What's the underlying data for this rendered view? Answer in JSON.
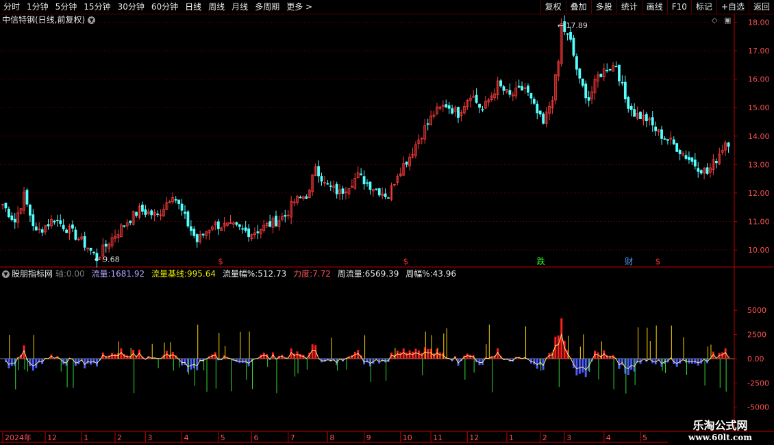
{
  "toolbar": {
    "left_items": [
      "分时",
      "1分钟",
      "5分钟",
      "15分钟",
      "30分钟",
      "60分钟",
      "日线",
      "周线",
      "月线",
      "多周期",
      "更多 >"
    ],
    "active": "日线",
    "right_items": [
      "复权",
      "叠加",
      "多股",
      "统计",
      "画线",
      "F10",
      "标记",
      "+自选",
      "返回"
    ]
  },
  "chart_title": "中信特钢(日线,前复权)",
  "price_axis": [
    "18.00",
    "17.00",
    "16.00",
    "15.00",
    "14.00",
    "13.00",
    "12.00",
    "11.00",
    "10.00"
  ],
  "high_label": "17.89",
  "low_label": "9.68",
  "event_marks": [
    {
      "text": "$",
      "color": "#ff3030",
      "day": 72
    },
    {
      "text": "$",
      "color": "#ff3030",
      "day": 133
    },
    {
      "text": "跌",
      "color": "#30ff30",
      "day": 177
    },
    {
      "text": "财",
      "color": "#4aa0ff",
      "day": 206
    },
    {
      "text": "$",
      "color": "#ff3030",
      "day": 216
    }
  ],
  "indicator": {
    "name": "股朋指标网",
    "axis_label": "轴:",
    "axis_value": "0.00",
    "flow_label": "流量:",
    "flow_value": "1681.92",
    "base_label": "流量基线:",
    "base_value": "995.64",
    "amp_label": "流量幅%:",
    "amp_value": "512.73",
    "force_label": "力度:",
    "force_value": "7.72",
    "week_flow_label": "周流量:",
    "week_flow_value": "6569.39",
    "week_amp_label": "周幅%:",
    "week_amp_value": "43.96",
    "axis_ticks": [
      "5000",
      "2500",
      "0.00",
      "-2500",
      "-5000"
    ]
  },
  "date_axis": [
    {
      "text": "2024年",
      "day": 0
    },
    {
      "text": "12",
      "day": 14
    },
    {
      "text": "1",
      "day": 26
    },
    {
      "text": "2",
      "day": 37
    },
    {
      "text": "3",
      "day": 47
    },
    {
      "text": "4",
      "day": 59
    },
    {
      "text": "5",
      "day": 71
    },
    {
      "text": "6",
      "day": 82
    },
    {
      "text": "7",
      "day": 94
    },
    {
      "text": "8",
      "day": 107
    },
    {
      "text": "9",
      "day": 119
    },
    {
      "text": "10",
      "day": 131
    },
    {
      "text": "11",
      "day": 141
    },
    {
      "text": "12",
      "day": 153
    },
    {
      "text": "1",
      "day": 166
    },
    {
      "text": "2",
      "day": 177
    },
    {
      "text": "3",
      "day": 185
    },
    {
      "text": "4",
      "day": 198
    },
    {
      "text": "5",
      "day": 210
    }
  ],
  "watermark": {
    "line1": "乐淘公式网",
    "line2": "www.60lt.com"
  },
  "colors": {
    "up": "#ff3b3b",
    "down": "#54ffff",
    "grid": "#7a0000",
    "axis": "#c00000",
    "pos_bar": "#ff2020",
    "neg_bar": "#4a5cff",
    "thin": "#ffd700"
  },
  "chart_data": {
    "type": "candlestick",
    "ylim": [
      9.4,
      18.3
    ],
    "close_series_anchors": [
      [
        0,
        11.6
      ],
      [
        4,
        11.0
      ],
      [
        7,
        11.9
      ],
      [
        11,
        10.6
      ],
      [
        17,
        11.1
      ],
      [
        23,
        10.6
      ],
      [
        28,
        10.1
      ],
      [
        31,
        9.7
      ],
      [
        35,
        10.3
      ],
      [
        40,
        10.9
      ],
      [
        45,
        11.4
      ],
      [
        51,
        11.2
      ],
      [
        56,
        12.0
      ],
      [
        61,
        10.9
      ],
      [
        64,
        10.3
      ],
      [
        69,
        10.9
      ],
      [
        76,
        10.8
      ],
      [
        82,
        10.6
      ],
      [
        88,
        10.9
      ],
      [
        93,
        11.2
      ],
      [
        96,
        11.7
      ],
      [
        101,
        12.0
      ],
      [
        103,
        13.0
      ],
      [
        106,
        12.3
      ],
      [
        111,
        12.0
      ],
      [
        117,
        12.6
      ],
      [
        122,
        12.2
      ],
      [
        127,
        11.9
      ],
      [
        130,
        12.7
      ],
      [
        134,
        13.3
      ],
      [
        138,
        14.1
      ],
      [
        142,
        14.8
      ],
      [
        146,
        15.1
      ],
      [
        150,
        14.8
      ],
      [
        154,
        15.5
      ],
      [
        158,
        14.9
      ],
      [
        163,
        15.8
      ],
      [
        167,
        15.4
      ],
      [
        172,
        15.7
      ],
      [
        175,
        15.0
      ],
      [
        178,
        14.4
      ],
      [
        181,
        15.4
      ],
      [
        183,
        16.6
      ],
      [
        184,
        17.9
      ],
      [
        187,
        17.3
      ],
      [
        190,
        15.9
      ],
      [
        193,
        15.3
      ],
      [
        196,
        16.1
      ],
      [
        199,
        16.4
      ],
      [
        202,
        16.5
      ],
      [
        205,
        15.3
      ],
      [
        208,
        14.8
      ],
      [
        212,
        14.6
      ],
      [
        216,
        14.1
      ],
      [
        220,
        13.8
      ],
      [
        224,
        13.4
      ],
      [
        228,
        13.0
      ],
      [
        232,
        12.7
      ],
      [
        235,
        13.2
      ],
      [
        238,
        13.8
      ]
    ],
    "indicator_ylim": [
      -7500,
      8200
    ]
  }
}
